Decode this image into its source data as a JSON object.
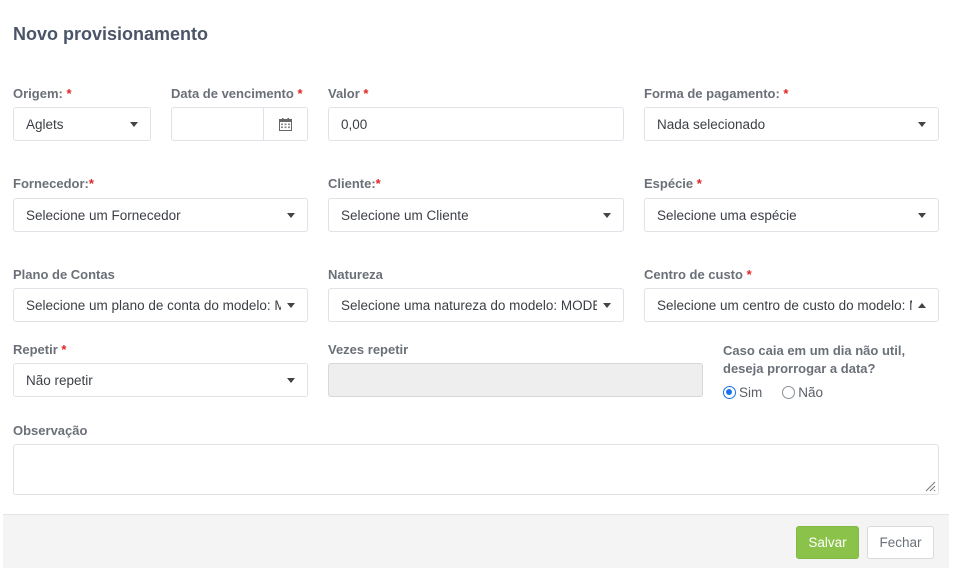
{
  "title": "Novo provisionamento",
  "required_mark": "*",
  "origem": {
    "label": "Origem: ",
    "value": "Aglets"
  },
  "data_vencimento": {
    "label": "Data de vencimento ",
    "value": ""
  },
  "valor": {
    "label": "Valor ",
    "value": "0,00"
  },
  "forma_pagamento": {
    "label": "Forma de pagamento: ",
    "value": "Nada selecionado"
  },
  "fornecedor": {
    "label": "Fornecedor:",
    "value": "Selecione um Fornecedor"
  },
  "cliente": {
    "label": "Cliente:",
    "value": "Selecione um Cliente"
  },
  "especie": {
    "label": "Espécie ",
    "value": "Selecione uma espécie"
  },
  "plano_contas": {
    "label": "Plano de Contas",
    "value": "Selecione um plano de conta do modelo: MODELO"
  },
  "natureza": {
    "label": "Natureza",
    "value": "Selecione uma natureza do modelo: MODELO"
  },
  "centro_custo": {
    "label": "Centro de custo ",
    "value": "Selecione um centro de custo do modelo: MODELO"
  },
  "repetir": {
    "label": "Repetir ",
    "value": "Não repetir"
  },
  "vezes_repetir": {
    "label": "Vezes repetir",
    "value": ""
  },
  "prorrogar": {
    "question_line1": "Caso caia em um dia não util,",
    "question_line2": "deseja prorrogar a data?",
    "options": [
      {
        "label": "Sim",
        "selected": true
      },
      {
        "label": "Não",
        "selected": false
      }
    ]
  },
  "observacao": {
    "label": "Observação",
    "value": ""
  },
  "footer": {
    "save_label": "Salvar",
    "close_label": "Fechar"
  },
  "colors": {
    "accent": "#8bc34a",
    "radio_selected": "#1a73e8",
    "required": "#e02424"
  },
  "icons": {
    "calendar": "calendar-icon",
    "dropdown": "caret-down-icon",
    "dropdown_open": "caret-up-icon"
  }
}
